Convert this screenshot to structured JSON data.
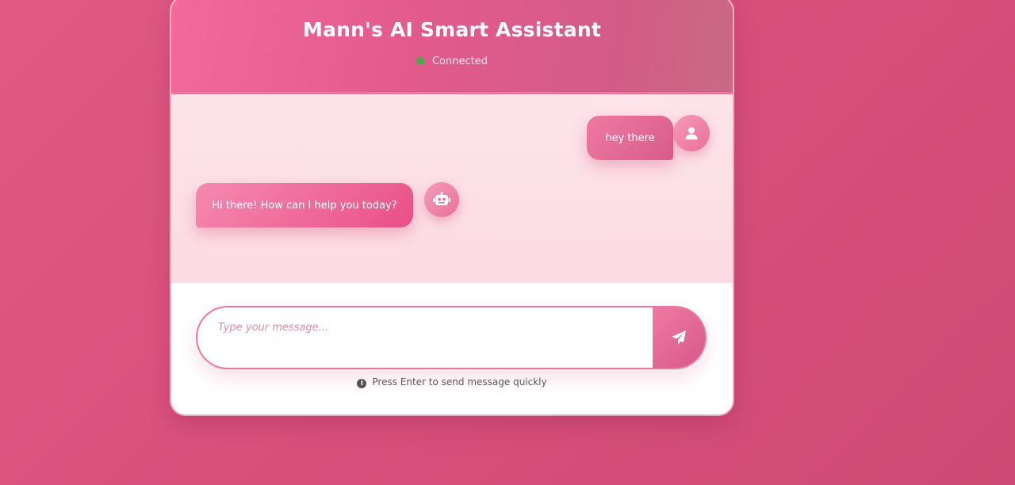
{
  "header": {
    "title": "Mann's AI Smart Assistant",
    "status": "Connected",
    "status_color": "#3dae4a"
  },
  "messages": [
    {
      "sender": "user",
      "text": "hey there",
      "avatar_icon": "user-icon"
    },
    {
      "sender": "bot",
      "text": "Hi there! How can I help you today?",
      "avatar_icon": "robot-icon"
    }
  ],
  "input": {
    "placeholder": "Type your message...",
    "value": "",
    "send_icon": "paper-plane-icon"
  },
  "hint": {
    "icon": "info-icon",
    "text": "Press Enter to send message quickly"
  },
  "colors": {
    "background": "#d84f7c",
    "accent": "#e9789f",
    "message_area": "#fde4ea"
  }
}
